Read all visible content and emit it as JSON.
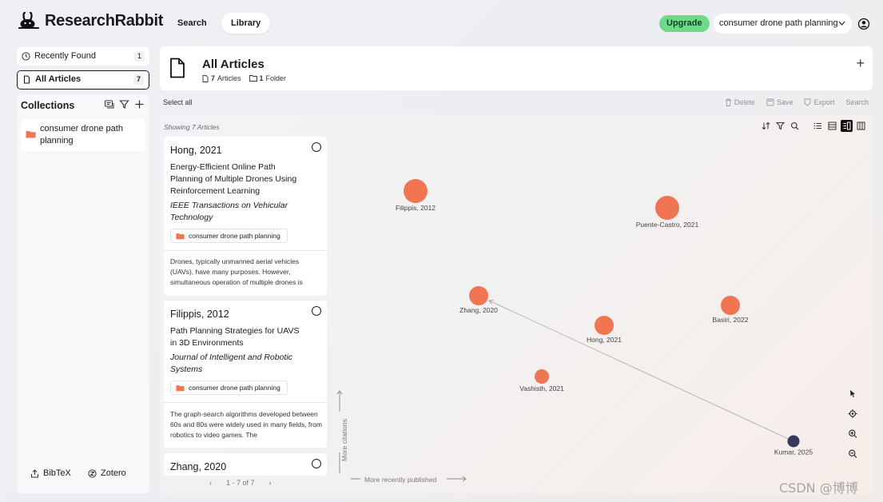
{
  "brand": {
    "name": "ResearchRabbit"
  },
  "nav": {
    "search": "Search",
    "library": "Library"
  },
  "header_right": {
    "upgrade": "Upgrade",
    "collection": "consumer drone path planning"
  },
  "sidebar": {
    "recently_found": {
      "label": "Recently Found",
      "count": "1"
    },
    "all_articles": {
      "label": "All Articles",
      "count": "7"
    },
    "collections_title": "Collections",
    "collection_item": "consumer drone path planning",
    "bibtex": "BibTeX",
    "zotero": "Zotero"
  },
  "main_header": {
    "title": "All Articles",
    "articles_count": "7",
    "articles_word": "Articles",
    "folders_count": "1",
    "folders_word": "Folder"
  },
  "toolbar": {
    "select_all": "Select all",
    "delete": "Delete",
    "save": "Save",
    "export": "Export",
    "search": "Search"
  },
  "list": {
    "showing": "Showing 7 Articles",
    "cards": [
      {
        "author": "Hong, 2021",
        "title": "Energy-Efficient Online Path Planning of Multiple Drones Using Reinforcement Learning",
        "journal": "IEEE Transactions on Vehicular Technology",
        "tag": "consumer drone path planning",
        "abstract": "Drones, typically unmanned aerial vehicles (UAVs), have many purposes. However, simultaneous operation of multiple drones is"
      },
      {
        "author": "Filippis, 2012",
        "title": "Path Planning Strategies for UAVS in 3D Environments",
        "journal": "Journal of Intelligent and Robotic Systems",
        "tag": "consumer drone path planning",
        "abstract": "The graph-search algorithms developed between 60s and 80s were widely used in many fields, from robotics to video games. The"
      },
      {
        "author": "Zhang, 2020"
      }
    ],
    "pager": {
      "prev": "‹",
      "range": "1 - 7 of 7",
      "next": "›"
    }
  },
  "graph": {
    "y_axis_label": "More citations",
    "x_axis_label": "More recently published",
    "node_color": "#f07653",
    "focus_color": "#333a5c",
    "nodes": [
      {
        "label": "Filippis, 2012",
        "size": "large"
      },
      {
        "label": "Puente-Castro, 2021",
        "size": "large"
      },
      {
        "label": "Zhang, 2020",
        "size": "medium"
      },
      {
        "label": "Basiri, 2022",
        "size": "medium"
      },
      {
        "label": "Hong, 2021",
        "size": "medium"
      },
      {
        "label": "Vashisth, 2021",
        "size": "small"
      },
      {
        "label": "Kumar, 2025",
        "size": "small",
        "focus": true
      }
    ],
    "edges": [
      {
        "from": "Kumar, 2025",
        "to": "Zhang, 2020"
      }
    ]
  },
  "watermark": "CSDN @博博"
}
